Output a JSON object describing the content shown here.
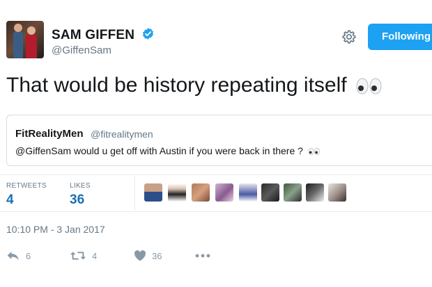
{
  "author": {
    "name": "SAM GIFFEN",
    "handle": "@GiffenSam",
    "verified": true
  },
  "header": {
    "follow_label": "Following",
    "settings_icon": "gear-icon"
  },
  "tweet": {
    "text": "That would be history repeating itself",
    "emoji": "eyes-emoji"
  },
  "quoted_tweet": {
    "name": "FitRealityMen",
    "handle": "@fitrealitymen",
    "text": "@GiffenSam would u get off with Austin if you were back in there ?"
  },
  "stats": {
    "retweets_label": "RETWEETS",
    "retweets_value": "4",
    "likes_label": "LIKES",
    "likes_value": "36"
  },
  "likers_count_shown": 9,
  "timestamp": "10:10 PM - 3 Jan 2017",
  "actions": {
    "reply_count": "6",
    "retweet_count": "4",
    "like_count": "36"
  },
  "colors": {
    "accent": "#1da1f2",
    "stat_value": "#1b6fb5",
    "muted": "#657786"
  }
}
